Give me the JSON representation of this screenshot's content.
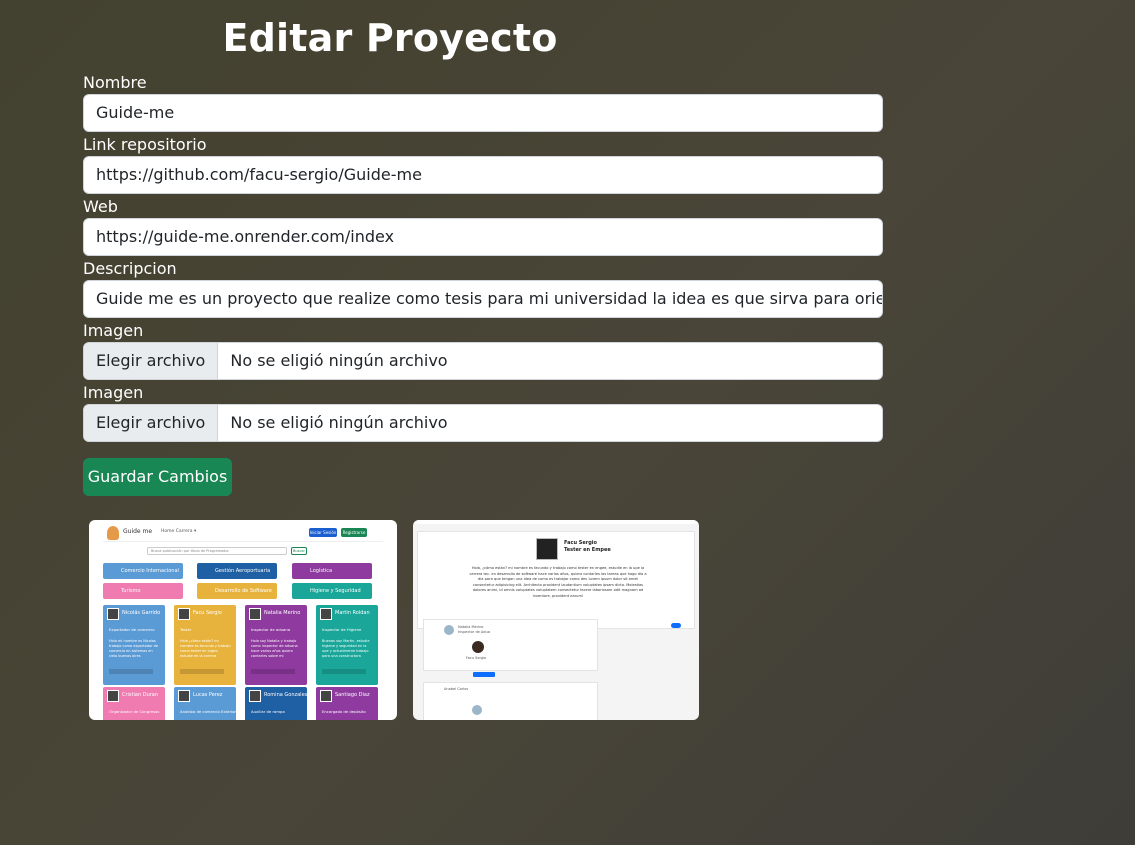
{
  "page": {
    "title": "Editar Proyecto"
  },
  "form": {
    "nombre": {
      "label": "Nombre",
      "value": "Guide-me"
    },
    "repo": {
      "label": "Link repositorio",
      "value": "https://github.com/facu-sergio/Guide-me"
    },
    "web": {
      "label": "Web",
      "value": "https://guide-me.onrender.com/index"
    },
    "descripcion": {
      "label": "Descripcion",
      "value": "Guide me es un proyecto que realize como tesis para mi universidad la idea es que sirva para orientar a los estudiantes"
    },
    "imagen1": {
      "label": "Imagen",
      "button": "Elegir archivo",
      "status": "No se eligió ningún archivo"
    },
    "imagen2": {
      "label": "Imagen",
      "button": "Elegir archivo",
      "status": "No se eligió ningún archivo"
    },
    "submit_label": "Guardar Cambios"
  },
  "previews": {
    "thumb1": {
      "brand": "Guide me",
      "menu": "Home  Carrera ▾",
      "login": "Iniciar Sesión",
      "register": "Registrarse",
      "search_placeholder": "Busca publicación por título de Programador",
      "search_button": "Buscar",
      "categories": [
        {
          "label": "Comercio Internacional",
          "color": "#5b9bd5"
        },
        {
          "label": "Gestión Aeroportuaria",
          "color": "#1f5fa3"
        },
        {
          "label": "Logística",
          "color": "#8e3a9e"
        },
        {
          "label": "Turismo",
          "color": "#f07bb1"
        },
        {
          "label": "Desarrollo de Software",
          "color": "#e8b33c"
        },
        {
          "label": "Higiene y Seguridad",
          "color": "#1aa79a"
        }
      ],
      "cards": [
        {
          "name": "Nicolás Garrido",
          "role": "Exportador de comercio",
          "color": "#5b9bd5",
          "text": "Hola mi nombre es Nicolas trabajo como exportador de comercio en sistemas en cielo buenos aires"
        },
        {
          "name": "Facu Sergio",
          "role": "Tester",
          "color": "#e8b33c",
          "text": "Hola ¿cómo están? mi nombre es facundo y trabajo como tester en ingee, estudie en la carrera"
        },
        {
          "name": "Natalia Merino",
          "role": "Inspector de aduana",
          "color": "#8e3a9e",
          "text": "Hola soy Natalia y trabajo como inspector de aduana hace varios años quiero contarles sobre mi"
        },
        {
          "name": "Martin Roldan",
          "role": "Inspector de Higiene",
          "color": "#1aa79a",
          "text": "Buenas soy Martín, estudie higiene y seguridad en la upe y actualmente trabajo para una constructora"
        },
        {
          "name": "Cristian Duran",
          "role": "Organizador de Congresos",
          "color": "#f07bb1",
          "text": ""
        },
        {
          "name": "Lucas Perez",
          "role": "Analista de comercio Exterior",
          "color": "#5b9bd5",
          "text": ""
        },
        {
          "name": "Romina Gonzales",
          "role": "Auxiliar de rampa",
          "color": "#1f5fa3",
          "text": ""
        },
        {
          "name": "Santiago Diaz",
          "role": "Encargado de depósito",
          "color": "#8e3a9e",
          "text": ""
        }
      ]
    },
    "thumb2": {
      "name": "Facu Sergio",
      "role": "Tester en Empee",
      "bio": "Hola, ¿cómo están? mi nombre es facundo y trabajo como tester en engee, estudie en la upe la carrera tec. en desarrollo de software hace varios años, quiero contarles las tareas que hago día a día para que tengan una idea de como es trabajar como dev Lorem ipsum dolor sit amet consectetur adipisicing elit. Architecto provident laudantium voluptates ipsam dicta. Molestias dolores animi, id omnis voluptates voluptatem consectetur facere laboriosam odit magnam ad inventore, provident earum!",
      "post1_user": "Natalia Merino",
      "post1_sub": "Inspector de Adua",
      "post1_reply": "Facu Sergio",
      "post2_user": "Anabel Carlos"
    }
  }
}
